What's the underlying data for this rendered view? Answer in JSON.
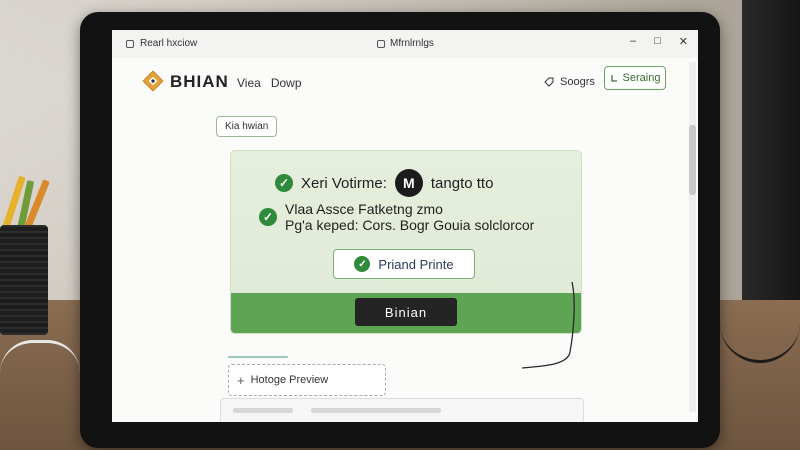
{
  "window": {
    "title_left": "Rearl hxciow",
    "title_center": "Mfrnlrnlgs",
    "controls": [
      "–",
      "□",
      "✕"
    ]
  },
  "header": {
    "brand": "BHIAN",
    "nav": [
      "Viea",
      "Dowp"
    ],
    "search_label": "Soogrs",
    "button_label": "Seraing"
  },
  "content": {
    "chip": "Kia hwian",
    "card": {
      "row1_text": "Xeri Votirme:",
      "row1_badge": "M",
      "row1_suffix": "tangto tto",
      "row2_line1": "Vlaa Assce Fatketng zmo",
      "row2_line2": "Pg'a keped: Cors. Bogr Gouia solclorcor",
      "print_button": "Priand Printe",
      "primary_button": "Binian"
    },
    "preview_button": "Hotoge Preview"
  },
  "colors": {
    "accent_green": "#5ea553",
    "check_green": "#2f8a3c",
    "card_bg": "#e6efdd"
  },
  "icons": [
    "window-app-icon",
    "diamond-logo-icon",
    "tag-icon",
    "arrow-icon",
    "check-icon",
    "plus-icon"
  ]
}
